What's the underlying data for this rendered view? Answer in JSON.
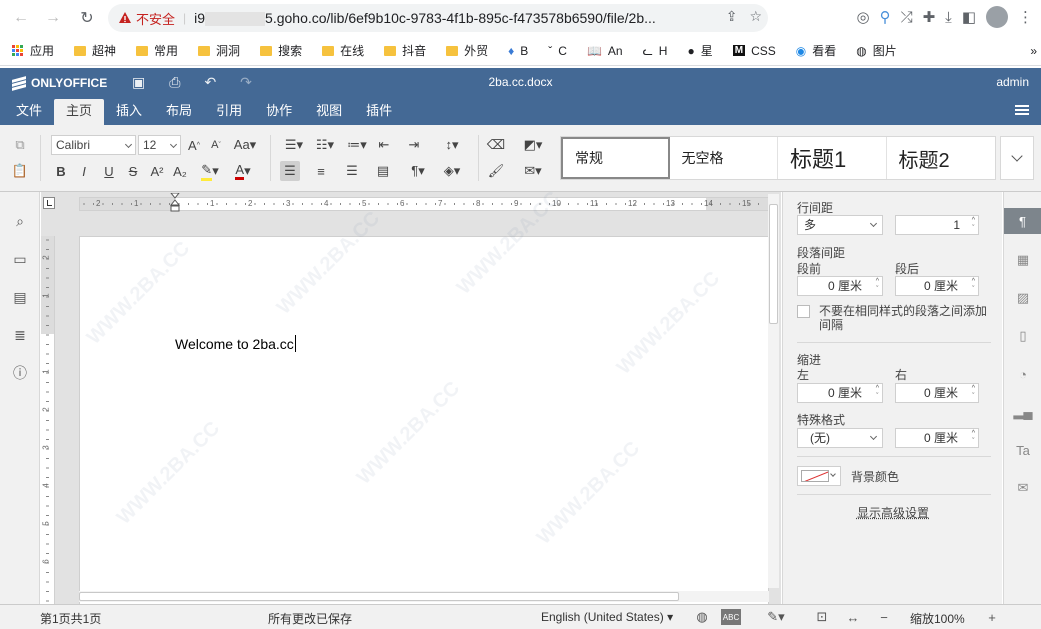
{
  "browser": {
    "security_label": "不安全",
    "url_prefix": "i9",
    "url_rest": "5.goho.co/lib/6ef9b10c-9783-4f1b-895c-f473578b6590/file/2b..."
  },
  "bookmarks": [
    "应用",
    "超神",
    "常用",
    "洞洞",
    "搜索",
    "在线",
    "抖音",
    "外贸",
    "B",
    "C",
    "An",
    "H",
    "星",
    "CSS",
    "看看",
    "图片"
  ],
  "app": {
    "brand": "ONLYOFFICE",
    "doc_title": "2ba.cc.docx",
    "user": "admin",
    "tabs": [
      "文件",
      "主页",
      "插入",
      "布局",
      "引用",
      "协作",
      "视图",
      "插件"
    ],
    "active_tab": "主页"
  },
  "toolbar": {
    "font_name": "Calibri",
    "font_size": "12",
    "styles": [
      "常规",
      "无空格",
      "标题1",
      "标题2"
    ]
  },
  "document": {
    "text": "Welcome to 2ba.cc",
    "watermark": "WWW.2BA.CC"
  },
  "ruler": {
    "h_ticks": [
      "2",
      "1",
      "1",
      "2",
      "3",
      "4",
      "5",
      "6",
      "7",
      "8",
      "9",
      "10",
      "11",
      "12",
      "13",
      "14",
      "15"
    ],
    "v_ticks": [
      "2",
      "1",
      "1",
      "2",
      "3",
      "4",
      "5",
      "6"
    ]
  },
  "panel": {
    "line_spacing_label": "行间距",
    "line_spacing_mode": "多",
    "line_spacing_value": "1",
    "para_spacing_label": "段落间距",
    "before_label": "段前",
    "before_value": "0 厘米",
    "after_label": "段后",
    "after_value": "0 厘米",
    "no_space_same_style": "不要在相同样式的段落之间添加间隔",
    "indent_label": "缩进",
    "left_label": "左",
    "left_value": "0 厘米",
    "right_label": "右",
    "right_value": "0 厘米",
    "special_label": "特殊格式",
    "special_value": "(无)",
    "special_amount": "0 厘米",
    "bg_color_label": "背景颜色",
    "advanced_link": "显示高级设置"
  },
  "status": {
    "page_info": "第1页共1页",
    "save_state": "所有更改已保存",
    "language": "English (United States)",
    "zoom": "缩放100%"
  }
}
